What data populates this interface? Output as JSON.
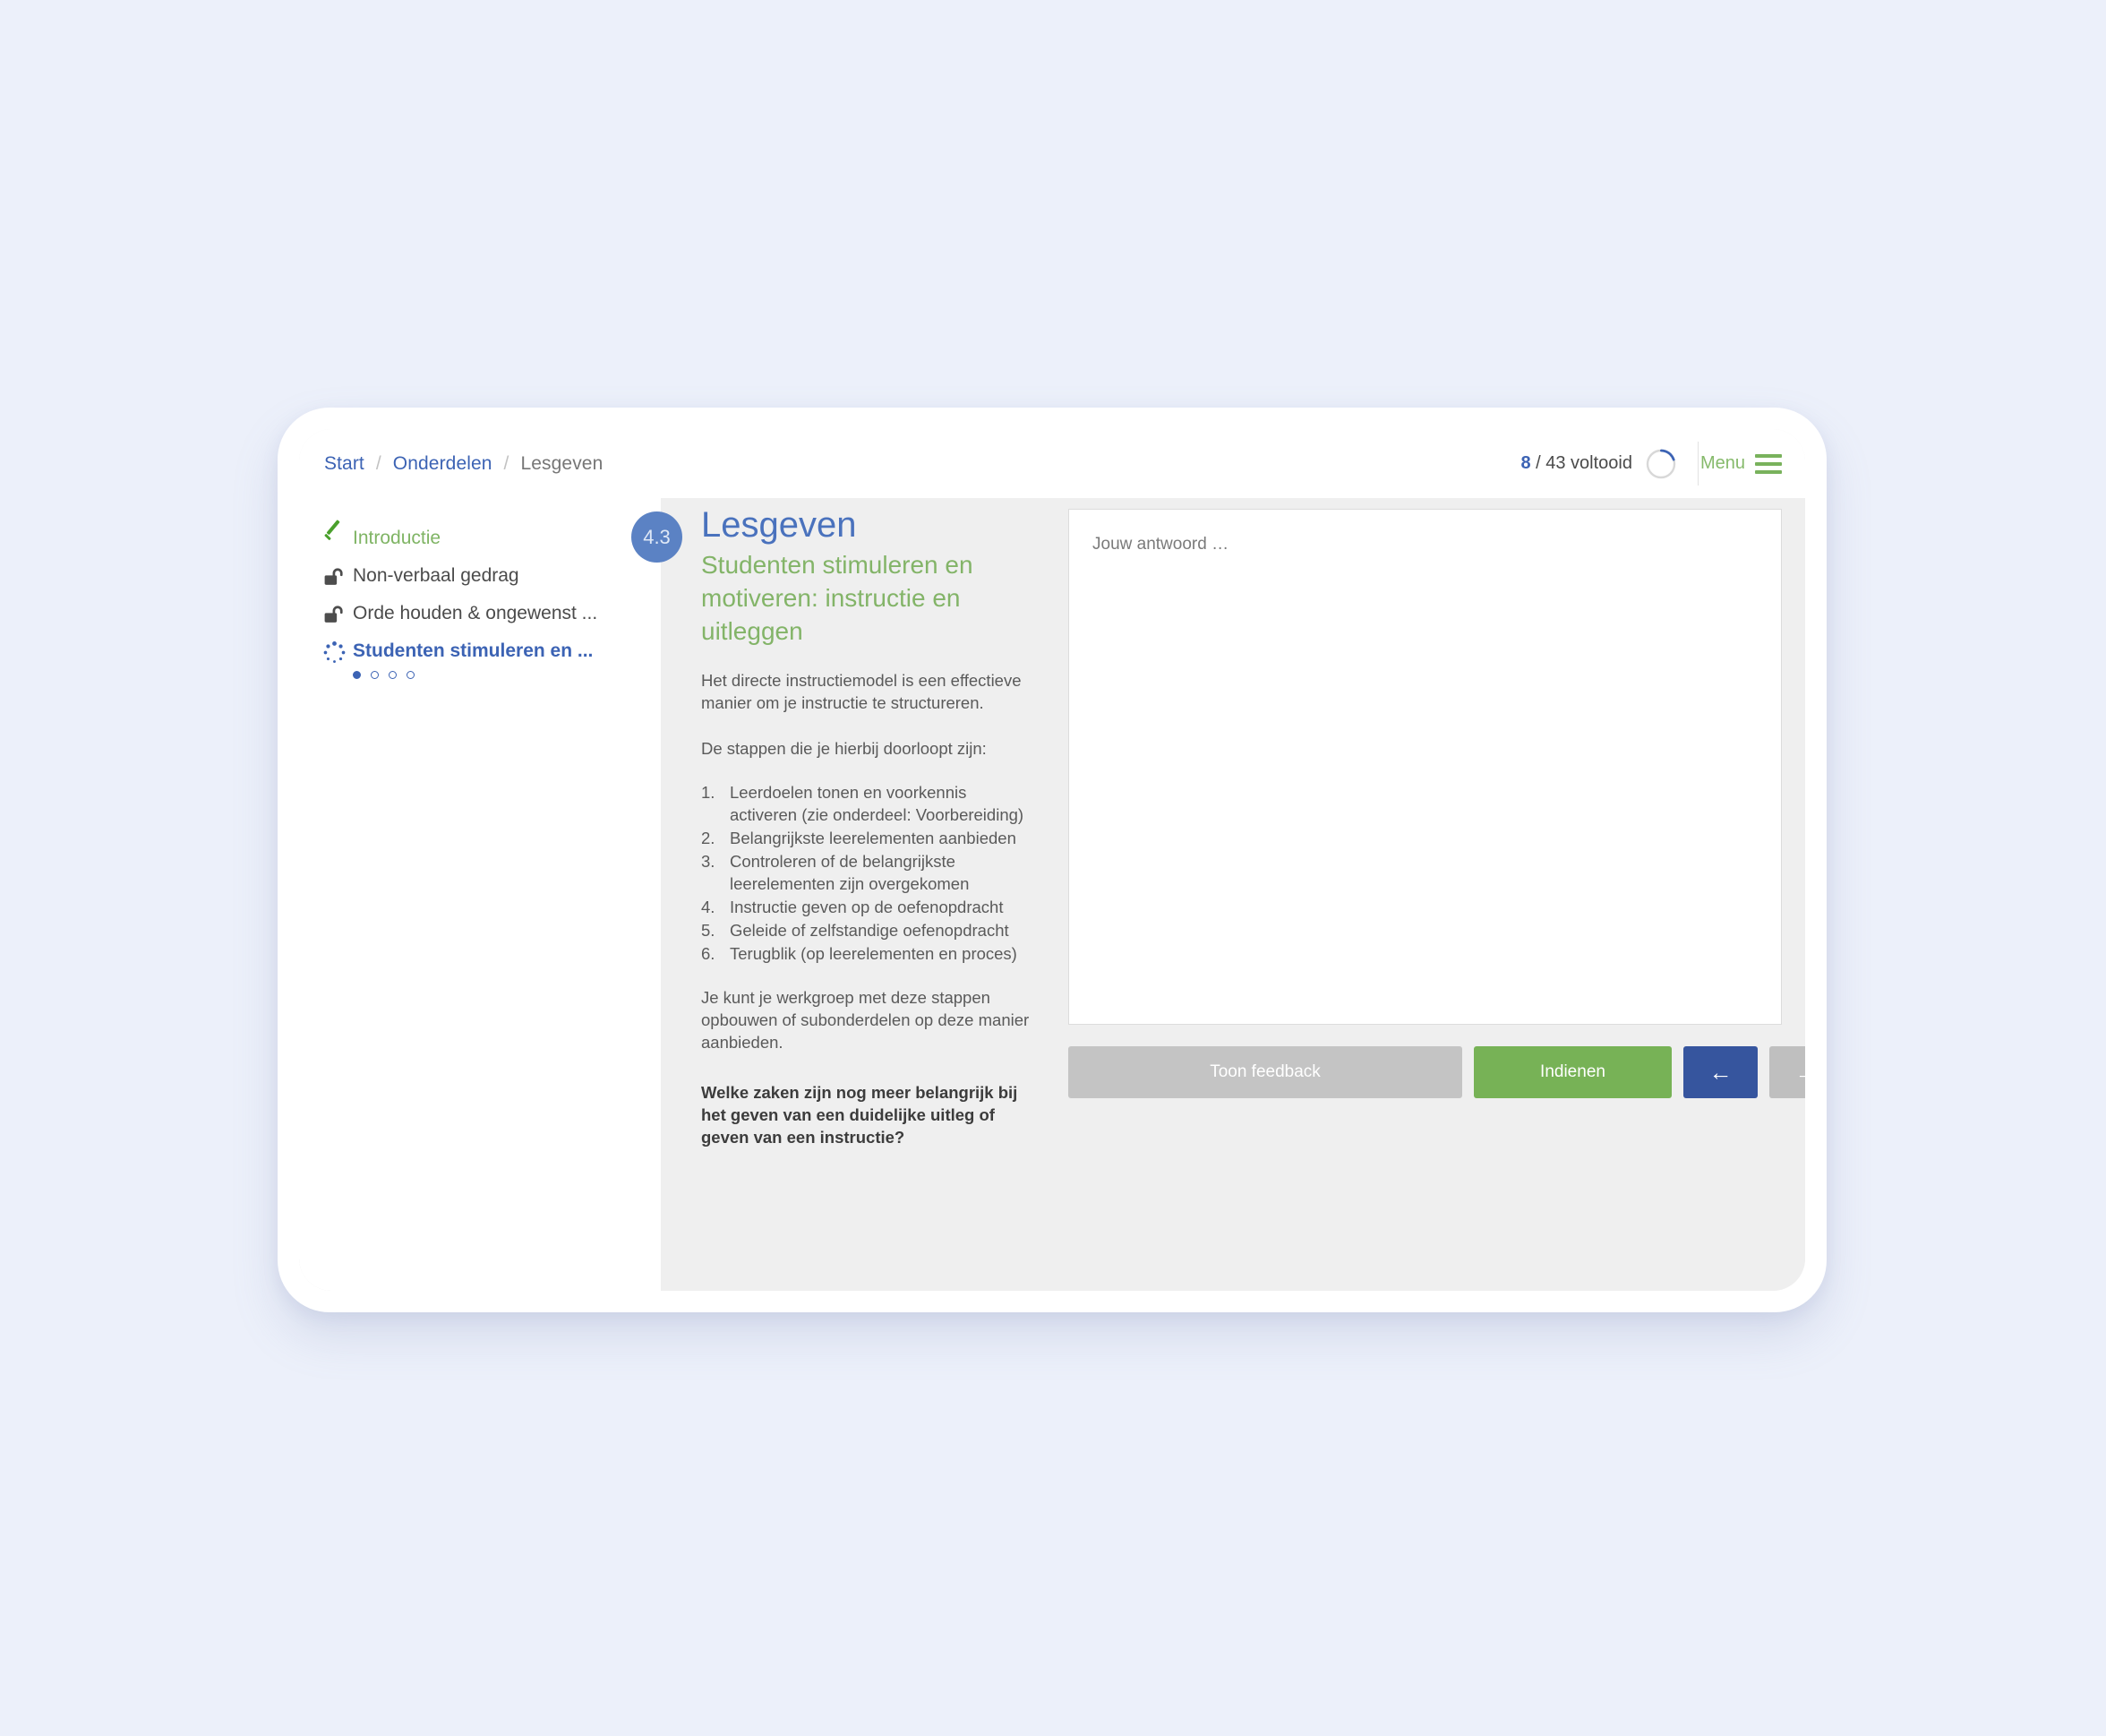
{
  "header": {
    "breadcrumb": [
      {
        "label": "Start",
        "type": "link"
      },
      {
        "label": "/",
        "type": "separator"
      },
      {
        "label": "Onderdelen",
        "type": "link"
      },
      {
        "label": "/",
        "type": "separator"
      },
      {
        "label": "Lesgeven",
        "type": "current"
      }
    ],
    "progress": {
      "completed": "8",
      "rest": "/ 43 voltooid",
      "total": 43,
      "done": 8,
      "percent": 19
    },
    "menu_label": "Menu",
    "menu_icon": "hamburger-icon"
  },
  "sidebar": {
    "items": [
      {
        "label": "Introductie",
        "icon": "check-icon",
        "state": "done"
      },
      {
        "label": "Non-verbaal gedrag",
        "icon": "unlocked-padlock-icon",
        "state": "locked"
      },
      {
        "label": "Orde houden & ongewenst ...",
        "icon": "unlocked-padlock-icon",
        "state": "locked"
      },
      {
        "label": "Studenten stimuleren en ...",
        "icon": "spinner-icon",
        "state": "active"
      }
    ],
    "sub_steps": {
      "count": 4,
      "active_index": 0
    }
  },
  "lesson": {
    "badge": "4.3",
    "title": "Lesgeven",
    "subtitle": "Studenten stimuleren en motiveren: instructie en uitleggen",
    "intro": "Het directe instructiemodel is een effectieve manier om je instructie te structureren.",
    "steps_lead": "De stappen die je hierbij doorloopt zijn:",
    "steps": [
      {
        "num": "1.",
        "text": "Leerdoelen tonen en voorkennis activeren (zie onderdeel: Voorbereiding)"
      },
      {
        "num": "2.",
        "text": "Belangrijkste leerelementen aanbieden"
      },
      {
        "num": "3.",
        "text": "Controleren of de belangrijkste leerelementen zijn overgekomen"
      },
      {
        "num": "4.",
        "text": "Instructie geven op de oefenopdracht"
      },
      {
        "num": "5.",
        "text": "Geleide of zelfstandige oefenopdracht"
      },
      {
        "num": "6.",
        "text": "Terugblik (op leerelementen en proces)"
      }
    ],
    "outro": "Je kunt je werkgroep met deze stappen opbouwen of subonderdelen op deze manier aanbieden.",
    "question": "Welke zaken zijn nog meer belangrijk bij het geven van een duidelijke uitleg of geven van een instructie?"
  },
  "answer": {
    "placeholder": "Jouw antwoord …",
    "value": ""
  },
  "actions": {
    "feedback_label": "Toon feedback",
    "submit_label": "Indienen",
    "prev_icon": "arrow-left-icon",
    "next_icon": "arrow-right-icon",
    "prev_label": "←",
    "next_label": "→"
  },
  "colors": {
    "page_background": "#ecf0fa",
    "card_background": "#efefef",
    "accent_blue": "#3c63b4",
    "accent_green": "#7fb464",
    "submit_green": "#77b256",
    "prev_blue": "#36559e",
    "disabled_gray": "#c4c4c4"
  }
}
